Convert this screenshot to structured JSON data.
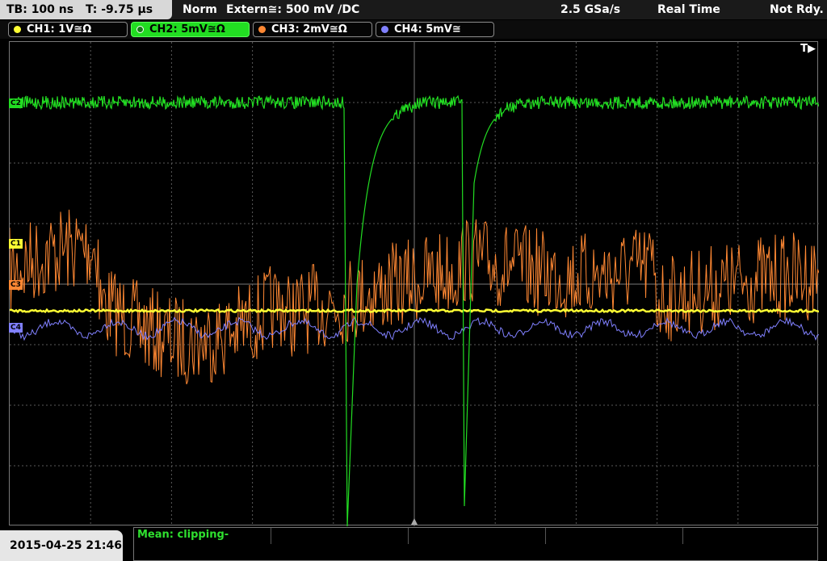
{
  "header": {
    "timebase": "TB: 100 ns",
    "trigger_time": "T: -9.75 µs",
    "mode": "Norm",
    "trigger_source": "Extern≅: 500 mV ∕DC",
    "sample_rate": "2.5 GSa/s",
    "acquisition": "Real Time",
    "state": "Not Rdy."
  },
  "channels": [
    {
      "label": "CH1: 1V≅Ω",
      "color": "#ffff33",
      "active": false
    },
    {
      "label": "CH2: 5mV≅Ω",
      "color": "#22dd22",
      "active": true
    },
    {
      "label": "CH3: 2mV≅Ω",
      "color": "#ff8833",
      "active": false
    },
    {
      "label": "CH4: 5mV≅",
      "color": "#8080ff",
      "active": false
    }
  ],
  "markers": {
    "c1": "C1",
    "c2": "C2",
    "c3": "C3",
    "c4": "C4",
    "trigger": "T▶"
  },
  "footer": {
    "datetime": "2015-04-25 21:46",
    "measurement": "Mean: clipping-"
  },
  "colors": {
    "ch1": "#ffff33",
    "ch2": "#22dd22",
    "ch3": "#ff8833",
    "ch4": "#8080ff",
    "grid": "#5a5a5a"
  }
}
